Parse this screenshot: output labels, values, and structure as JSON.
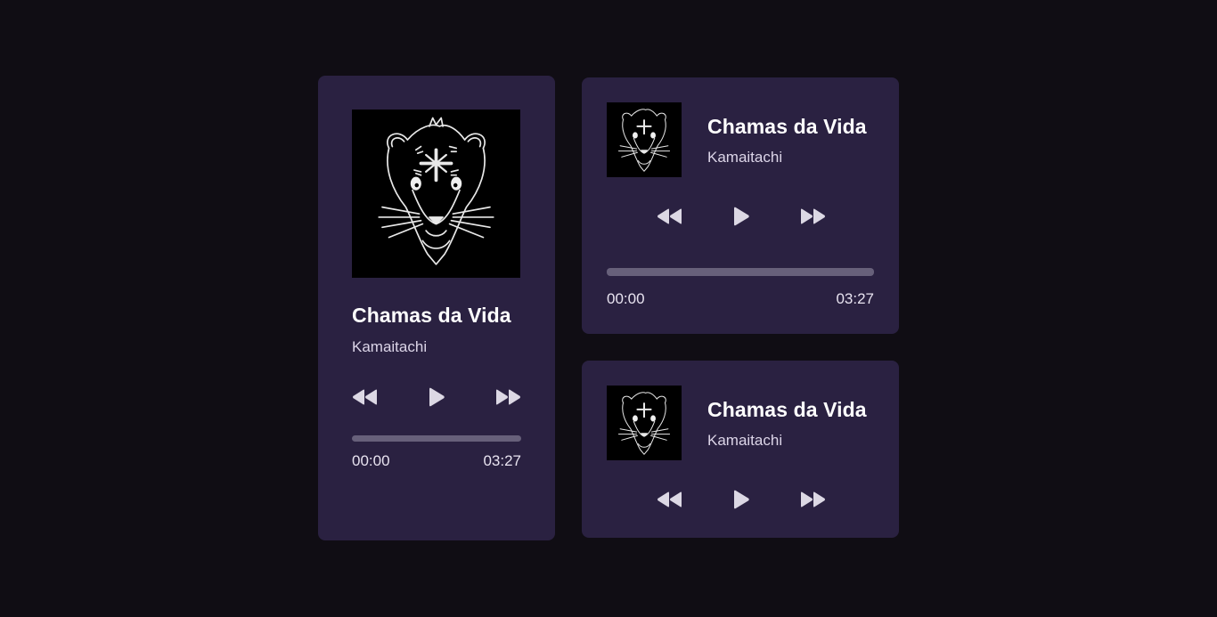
{
  "track": {
    "title": "Chamas da Vida",
    "artist": "Kamaitachi",
    "current_time": "00:00",
    "duration": "03:27",
    "progress_fraction": 0
  },
  "colors": {
    "background": "#100d14",
    "card": "#2a2141",
    "text": "#ffffff",
    "subtext": "#dcd5e8",
    "progress_track": "#67607a",
    "icon": "#dcd8e4"
  },
  "icons": {
    "prev": "rewind-icon",
    "play": "play-icon",
    "next": "fast-forward-icon",
    "cover": "album-art-rat-illustration"
  }
}
